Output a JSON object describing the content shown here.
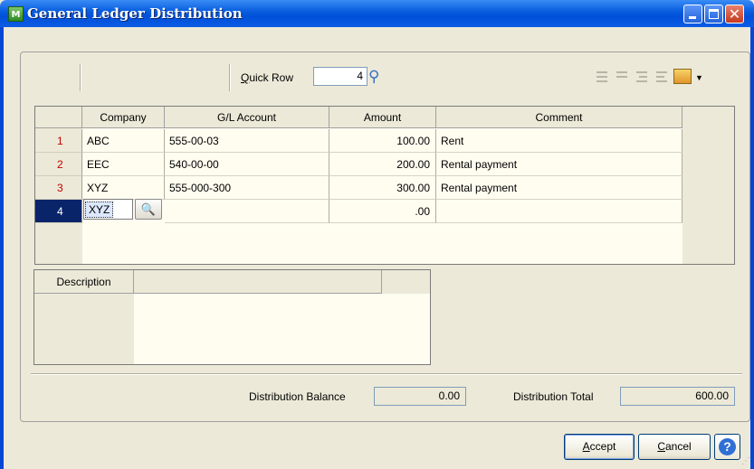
{
  "window": {
    "title": "General Ledger Distribution",
    "app_icon": "mas-app-icon",
    "title_color": "#0a5fe0"
  },
  "toolbar": {
    "quick_row_label": "Quick Row",
    "quick_row_value": "4",
    "quick_row_icon": "binoculars-lookup-icon",
    "row_tools": [
      "insert-row-icon",
      "delete-row-icon",
      "indent-icon",
      "outdent-icon",
      "customize-grid-icon"
    ]
  },
  "grid": {
    "columns": [
      "Company",
      "G/L Account",
      "Amount",
      "Comment"
    ],
    "rows": [
      {
        "num": "1",
        "company": "ABC",
        "account": "555-00-03",
        "amount": "100.00",
        "comment": "Rent"
      },
      {
        "num": "2",
        "company": "EEC",
        "account": "540-00-00",
        "amount": "200.00",
        "comment": "Rental payment"
      },
      {
        "num": "3",
        "company": "XYZ",
        "account": "555-000-300",
        "amount": "300.00",
        "comment": "Rental payment"
      },
      {
        "num": "4",
        "company": "XYZ",
        "account": "",
        "amount": ".00",
        "comment": ""
      }
    ],
    "active_row": 4
  },
  "description": {
    "header": "Description"
  },
  "totals": {
    "balance_label": "Distribution Balance",
    "balance_value": "0.00",
    "total_label": "Distribution Total",
    "total_value": "600.00"
  },
  "buttons": {
    "accept": "ccept",
    "accept_key": "A",
    "cancel": "ancel",
    "cancel_key": "C",
    "help": "?"
  }
}
